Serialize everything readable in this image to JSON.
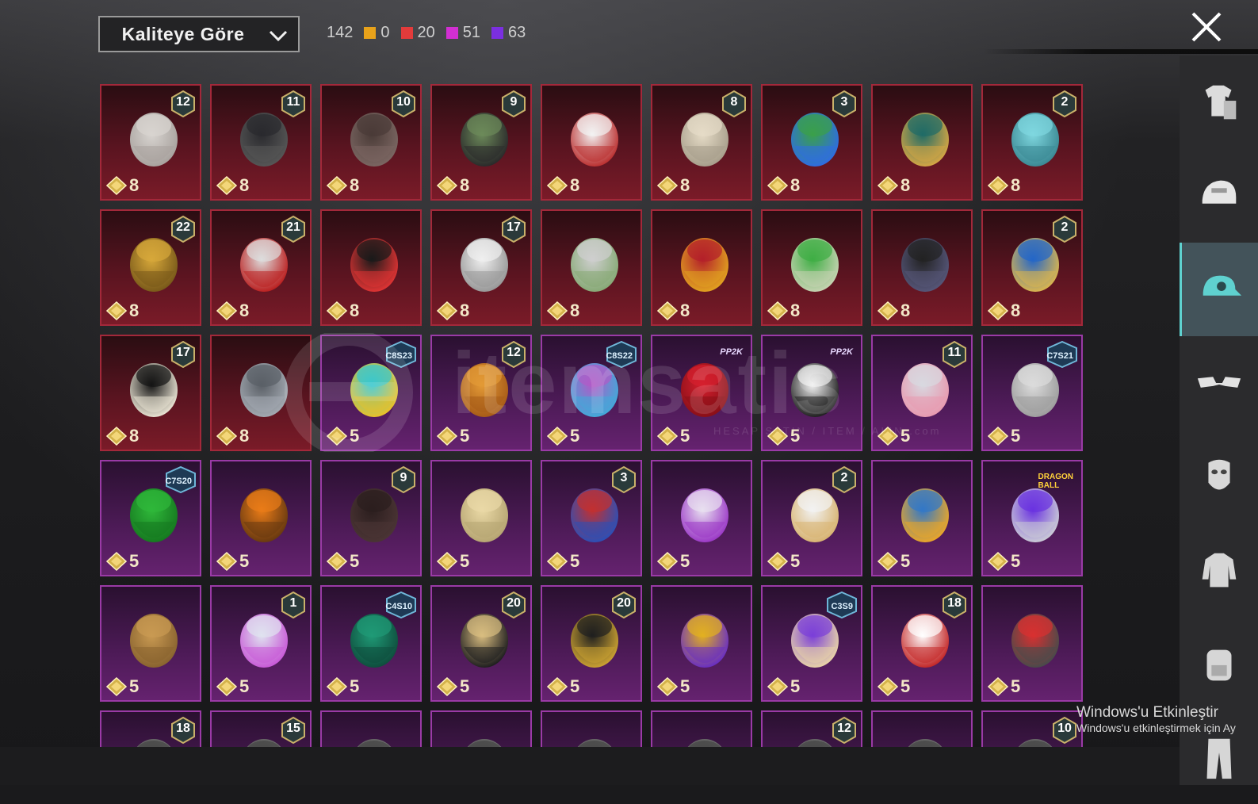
{
  "header": {
    "sort_label": "Kaliteye Göre",
    "total_count": "142",
    "rarity_counts": [
      {
        "color": "#e8a21a",
        "count": "0"
      },
      {
        "color": "#e33b3b",
        "count": "20"
      },
      {
        "color": "#d22fd2",
        "count": "51"
      },
      {
        "color": "#7b2fe0",
        "count": "63"
      }
    ]
  },
  "sidebar": {
    "tabs": [
      {
        "name": "outfit-icon",
        "active": false
      },
      {
        "name": "helmet-icon",
        "active": false
      },
      {
        "name": "cap-icon",
        "active": true
      },
      {
        "name": "glasses-icon",
        "active": false
      },
      {
        "name": "mask-icon",
        "active": false
      },
      {
        "name": "jacket-icon",
        "active": false
      },
      {
        "name": "backpack-icon",
        "active": false
      },
      {
        "name": "pants-icon",
        "active": false
      }
    ]
  },
  "items": [
    {
      "rarity": "red",
      "qty": "8",
      "badge": "12",
      "art": "white-hair"
    },
    {
      "rarity": "red",
      "qty": "8",
      "badge": "11",
      "art": "black-hair"
    },
    {
      "rarity": "red",
      "qty": "8",
      "badge": "10",
      "art": "brown-hair"
    },
    {
      "rarity": "red",
      "qty": "8",
      "badge": "9",
      "art": "green-head"
    },
    {
      "rarity": "red",
      "qty": "8",
      "badge": "",
      "art": "white-hat"
    },
    {
      "rarity": "red",
      "qty": "8",
      "badge": "8",
      "art": "blonde-hair"
    },
    {
      "rarity": "red",
      "qty": "8",
      "badge": "3",
      "art": "joker-head"
    },
    {
      "rarity": "red",
      "qty": "8",
      "badge": "",
      "art": "teal-helmet"
    },
    {
      "rarity": "red",
      "qty": "8",
      "badge": "2",
      "art": "cyan-hat"
    },
    {
      "rarity": "red",
      "qty": "8",
      "badge": "22",
      "art": "gold-helmet"
    },
    {
      "rarity": "red",
      "qty": "8",
      "badge": "21",
      "art": "demon-mask"
    },
    {
      "rarity": "red",
      "qty": "8",
      "badge": "",
      "art": "fox-mask"
    },
    {
      "rarity": "red",
      "qty": "8",
      "badge": "17",
      "art": "white-hair-2"
    },
    {
      "rarity": "red",
      "qty": "8",
      "badge": "",
      "art": "silver-hair"
    },
    {
      "rarity": "red",
      "qty": "8",
      "badge": "",
      "art": "red-helmet"
    },
    {
      "rarity": "red",
      "qty": "8",
      "badge": "",
      "art": "green-helmet"
    },
    {
      "rarity": "red",
      "qty": "8",
      "badge": "",
      "art": "black-helmet"
    },
    {
      "rarity": "red",
      "qty": "8",
      "badge": "2",
      "art": "blue-helmet"
    },
    {
      "rarity": "red",
      "qty": "8",
      "badge": "17",
      "art": "black-mask"
    },
    {
      "rarity": "red",
      "qty": "8",
      "badge": "",
      "art": "grey-helmet"
    },
    {
      "rarity": "purple",
      "qty": "5",
      "badge": "",
      "tag": "C8S23",
      "art": "cat-headset"
    },
    {
      "rarity": "purple",
      "qty": "5",
      "badge": "12",
      "art": "orange-hair"
    },
    {
      "rarity": "purple",
      "qty": "5",
      "badge": "",
      "tag": "C8S22",
      "art": "pink-hair"
    },
    {
      "rarity": "purple",
      "qty": "5",
      "badge": "",
      "tag": "PP2K",
      "art": "red-hair"
    },
    {
      "rarity": "purple",
      "qty": "5",
      "badge": "",
      "tag": "PP2K",
      "art": "panda-head"
    },
    {
      "rarity": "purple",
      "qty": "5",
      "badge": "11",
      "art": "flower-hair"
    },
    {
      "rarity": "purple",
      "qty": "5",
      "badge": "",
      "tag": "C7S21",
      "art": "silver-hair-2"
    },
    {
      "rarity": "purple",
      "qty": "5",
      "badge": "",
      "tag": "C7S20",
      "art": "green-hair"
    },
    {
      "rarity": "purple",
      "qty": "5",
      "badge": "",
      "art": "pumpkin-head"
    },
    {
      "rarity": "purple",
      "qty": "5",
      "badge": "9",
      "art": "dark-hair"
    },
    {
      "rarity": "purple",
      "qty": "5",
      "badge": "",
      "art": "blonde-curls"
    },
    {
      "rarity": "purple",
      "qty": "5",
      "badge": "3",
      "art": "jester-hat"
    },
    {
      "rarity": "purple",
      "qty": "5",
      "badge": "",
      "art": "rabbit-mask"
    },
    {
      "rarity": "purple",
      "qty": "5",
      "badge": "2",
      "art": "sailor-hat"
    },
    {
      "rarity": "purple",
      "qty": "5",
      "badge": "",
      "art": "fish-hat"
    },
    {
      "rarity": "purple",
      "qty": "5",
      "badge": "",
      "tag": "DRAGON BALL",
      "art": "purple-helmet"
    },
    {
      "rarity": "purple",
      "qty": "5",
      "badge": "",
      "art": "potato-head"
    },
    {
      "rarity": "purple",
      "qty": "5",
      "badge": "1",
      "art": "candy-hair"
    },
    {
      "rarity": "purple",
      "qty": "5",
      "badge": "",
      "tag": "C4S10",
      "art": "green-knight"
    },
    {
      "rarity": "purple",
      "qty": "5",
      "badge": "20",
      "art": "bunny-hat"
    },
    {
      "rarity": "purple",
      "qty": "5",
      "badge": "20",
      "art": "gold-black-mask"
    },
    {
      "rarity": "purple",
      "qty": "5",
      "badge": "",
      "art": "tribal-mask"
    },
    {
      "rarity": "purple",
      "qty": "5",
      "badge": "",
      "tag": "C3S9",
      "art": "purple-cap"
    },
    {
      "rarity": "purple",
      "qty": "5",
      "badge": "18",
      "art": "uncle-sam-hat"
    },
    {
      "rarity": "purple",
      "qty": "5",
      "badge": "",
      "art": "red-headphones"
    },
    {
      "rarity": "purple",
      "qty": "",
      "badge": "18",
      "art": "partial"
    },
    {
      "rarity": "purple",
      "qty": "",
      "badge": "15",
      "art": "partial"
    },
    {
      "rarity": "purple",
      "qty": "",
      "badge": "",
      "art": "partial"
    },
    {
      "rarity": "purple",
      "qty": "",
      "badge": "",
      "art": "partial"
    },
    {
      "rarity": "purple",
      "qty": "",
      "badge": "",
      "art": "partial"
    },
    {
      "rarity": "purple",
      "qty": "",
      "badge": "",
      "art": "partial"
    },
    {
      "rarity": "purple",
      "qty": "",
      "badge": "12",
      "art": "partial"
    },
    {
      "rarity": "purple",
      "qty": "",
      "badge": "",
      "art": "partial"
    },
    {
      "rarity": "purple",
      "qty": "",
      "badge": "10",
      "art": "partial"
    }
  ],
  "watermark": {
    "text": "itemsatis",
    "sub": "HESAP SATIN / ITEM / ALIN .com"
  },
  "activation": {
    "title": "Windows'u Etkinleştir",
    "subtitle": "Windows'u etkinleştirmek için Ay"
  }
}
